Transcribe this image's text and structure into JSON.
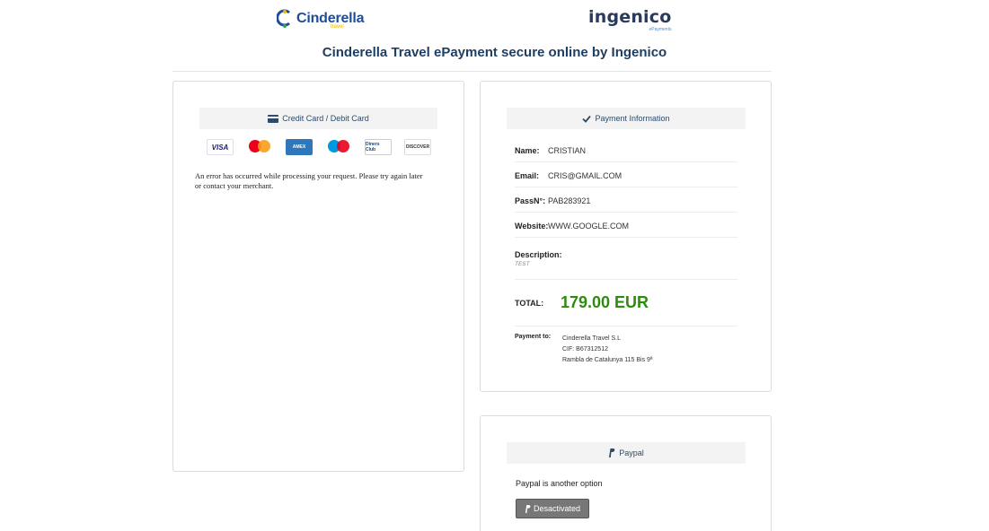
{
  "header": {
    "brand_left": "Cinderella",
    "brand_left_sub": "travel",
    "brand_right": "ingenico",
    "brand_right_sub": "ePayments",
    "title": "Cinderella Travel ePayment secure online by Ingenico"
  },
  "card_panel": {
    "heading": "Credit Card / Debit Card",
    "heading_icon": "credit-card-icon",
    "cards": [
      "VISA",
      "mastercard",
      "AMEX",
      "Maestro",
      "Diners Club",
      "DISCOVER"
    ],
    "error_message": "An error has occurred while processing your request. Please try again later or contact your merchant."
  },
  "payment_info": {
    "heading": "Payment Information",
    "heading_icon": "checkmark-icon",
    "name_label": "Name:",
    "name_value": "CRISTIAN",
    "email_label": "Email:",
    "email_value": "CRIS@GMAIL.COM",
    "pass_label": "PassN°:",
    "pass_value": "PAB283921",
    "website_label": "Website:",
    "website_value": "WWW.GOOGLE.COM",
    "description_label": "Description:",
    "description_value": "TEST",
    "total_label": "TOTAL:",
    "total_value": "179.00 EUR",
    "payto_label": "Payment to:",
    "payto_line1": "Cinderella Travel S.L",
    "payto_line2": "CIF: B67312512",
    "payto_line3": "Rambla de Catalunya 115 Bis 9ª"
  },
  "paypal": {
    "heading": "Paypal",
    "heading_icon": "paypal-icon",
    "text": "Paypal is another option",
    "button_label": "Desactivated"
  },
  "colors": {
    "title": "#1f3e63",
    "total": "#2e8b0f",
    "button": "#777777",
    "panel_header": "#f3f3f3"
  }
}
